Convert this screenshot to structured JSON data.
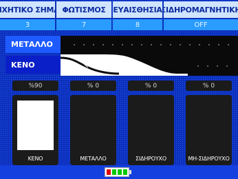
{
  "header": {
    "cells": [
      {
        "label": "ΗΧΗΤΙΚΟ ΣΗΜΑ",
        "value": "3"
      },
      {
        "label": "ΦΩΤΙΣΜΟΣ",
        "value": "7"
      },
      {
        "label": "ΕΥΑΙΣΘΗΣΙΑ",
        "value": "8"
      },
      {
        "label": "ΣΙΔΗΡΟΜΑΓΝΗΤΙΚΗ",
        "value": "OFF"
      }
    ]
  },
  "material_bar": {
    "metal_label": "ΜΕΤΑΛΛΟ",
    "empty_label": "ΚΕΝΟ"
  },
  "gauges": [
    {
      "percent_text": "%90",
      "caption": "ΚΕΝΟ",
      "level": 0.9
    },
    {
      "percent_text": "% 0",
      "caption": "ΜΕΤΑΛΛΟ",
      "level": 0
    },
    {
      "percent_text": "% 0",
      "caption": "ΣΙΔΗΡΟΥΧΟ",
      "level": 0
    },
    {
      "percent_text": "% 0",
      "caption": "ΜΗ-ΣΙΔΗΡΟΥΧΟ",
      "level": 0
    }
  ],
  "battery": {
    "icon": "battery-icon",
    "level": 0.75
  }
}
